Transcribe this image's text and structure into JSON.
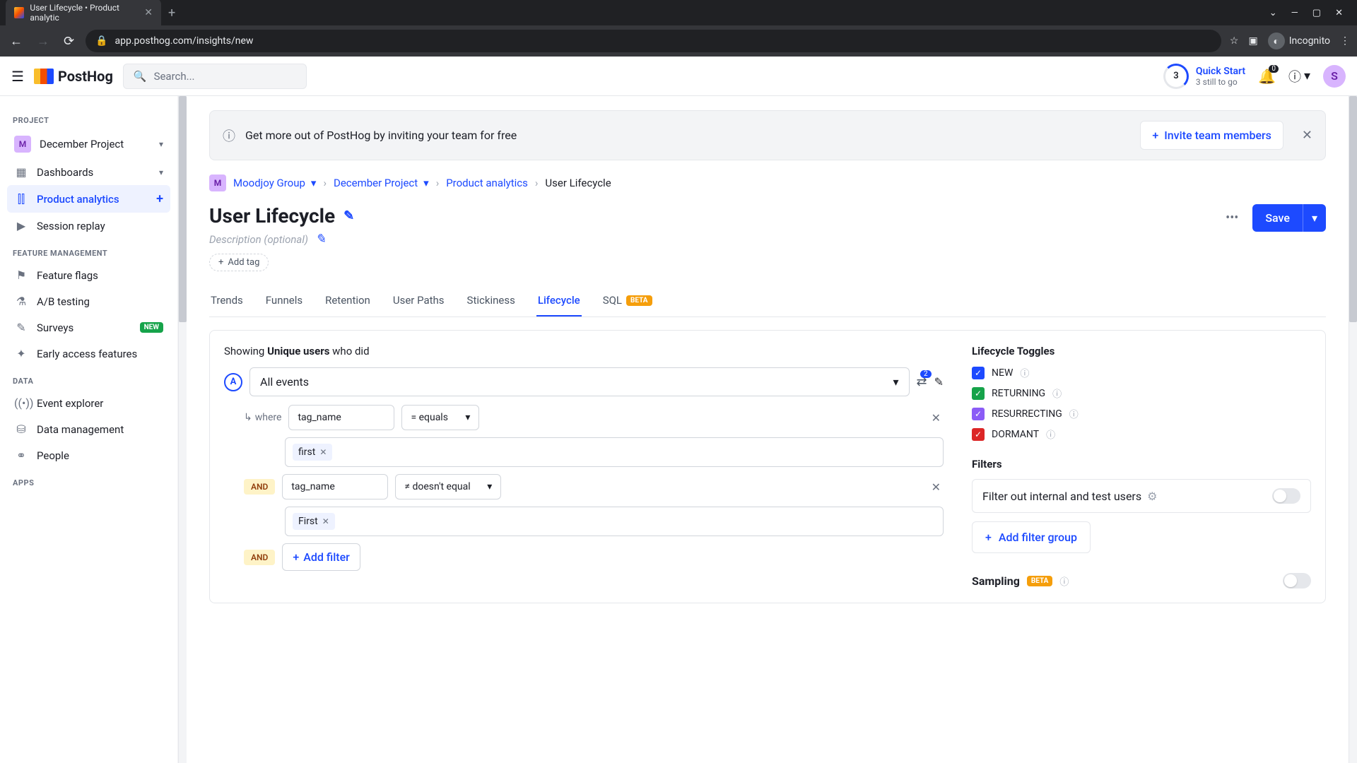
{
  "browser": {
    "tab_title": "User Lifecycle • Product analytic",
    "url": "app.posthog.com/insights/new",
    "incognito": "Incognito"
  },
  "header": {
    "search_placeholder": "Search...",
    "quick_start": {
      "badge": "3",
      "title": "Quick Start",
      "subtitle": "3 still to go"
    },
    "bell_count": "0",
    "avatar_letter": "S"
  },
  "sidebar": {
    "project_section": "PROJECT",
    "project_name": "December Project",
    "project_letter": "M",
    "items_main": [
      {
        "icon": "▦",
        "label": "Dashboards",
        "chev": true
      },
      {
        "icon": "⫿⫿",
        "label": "Product analytics",
        "active": true,
        "plus": true
      },
      {
        "icon": "▶",
        "label": "Session replay"
      }
    ],
    "feature_section": "FEATURE MANAGEMENT",
    "items_feature": [
      {
        "icon": "⚑",
        "label": "Feature flags"
      },
      {
        "icon": "⚗",
        "label": "A/B testing"
      },
      {
        "icon": "✎",
        "label": "Surveys",
        "new": true
      },
      {
        "icon": "✦",
        "label": "Early access features"
      }
    ],
    "data_section": "DATA",
    "items_data": [
      {
        "icon": "((•))",
        "label": "Event explorer"
      },
      {
        "icon": "⛁",
        "label": "Data management"
      },
      {
        "icon": "⚭",
        "label": "People"
      }
    ],
    "apps_section": "APPS",
    "new_badge": "NEW"
  },
  "banner": {
    "text": "Get more out of PostHog by inviting your team for free",
    "button": "Invite team members"
  },
  "breadcrumb": {
    "org_letter": "M",
    "org": "Moodjoy Group",
    "project": "December Project",
    "section": "Product analytics",
    "page": "User Lifecycle"
  },
  "page": {
    "title": "User Lifecycle",
    "description": "Description (optional)",
    "add_tag": "Add tag",
    "save": "Save"
  },
  "tabs": [
    "Trends",
    "Funnels",
    "Retention",
    "User Paths",
    "Stickiness",
    "Lifecycle",
    "SQL"
  ],
  "tabs_active": "Lifecycle",
  "beta_label": "BETA",
  "config": {
    "showing_prefix": "Showing ",
    "showing_bold": "Unique users",
    "showing_suffix": " who did",
    "series_letter": "A",
    "event": "All events",
    "filter_count": "2",
    "where": "where",
    "and": "AND",
    "filters": [
      {
        "property": "tag_name",
        "operator": "= equals",
        "value": "first"
      },
      {
        "property": "tag_name",
        "operator": "≠ doesn't equal",
        "value": "First"
      }
    ],
    "add_filter": "Add filter"
  },
  "right": {
    "toggles_title": "Lifecycle Toggles",
    "toggles": [
      {
        "color": "blue",
        "label": "NEW"
      },
      {
        "color": "green",
        "label": "RETURNING"
      },
      {
        "color": "purple",
        "label": "RESURRECTING"
      },
      {
        "color": "red",
        "label": "DORMANT"
      }
    ],
    "filters_title": "Filters",
    "filter_internal": "Filter out internal and test users",
    "add_group": "Add filter group",
    "sampling": "Sampling"
  }
}
